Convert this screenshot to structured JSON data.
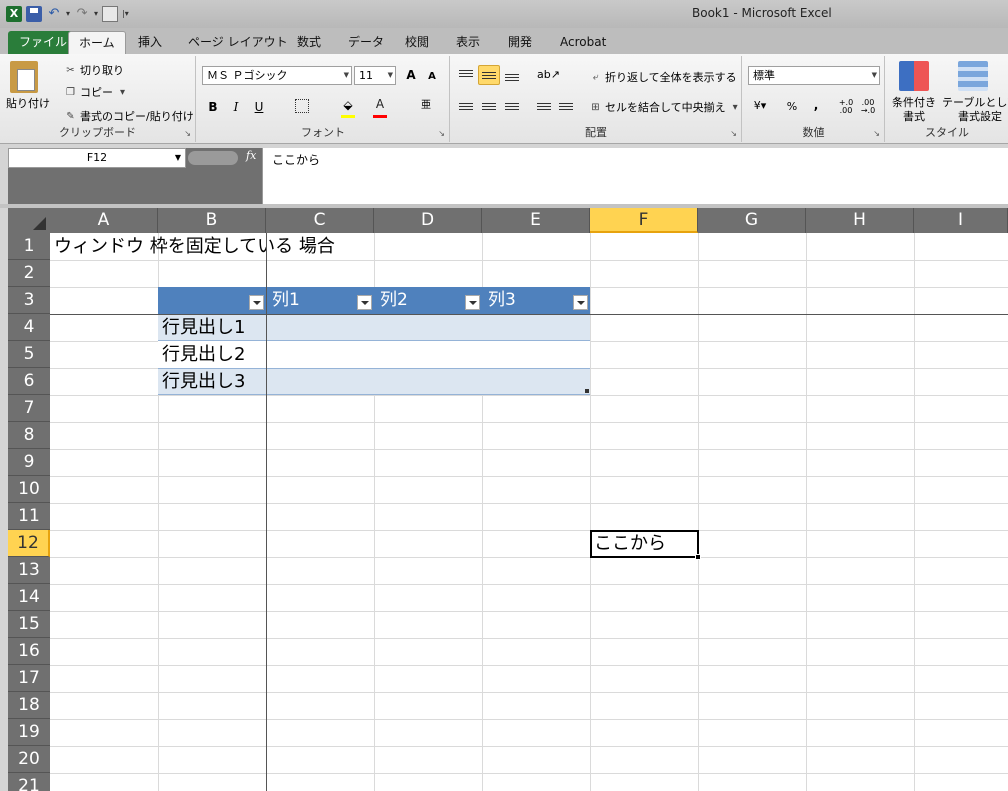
{
  "window": {
    "title": "Book1 - Microsoft Excel"
  },
  "quick_access": {
    "icons": [
      "excel-app-icon",
      "save-icon",
      "undo-icon",
      "redo-icon",
      "print-preview-icon"
    ]
  },
  "tabs": [
    "ファイル",
    "ホーム",
    "挿入",
    "ページ レイアウト",
    "数式",
    "データ",
    "校閲",
    "表示",
    "開発",
    "Acrobat"
  ],
  "ribbon": {
    "clipboard": {
      "label": "クリップボード",
      "paste": "貼り付け",
      "cut": "切り取り",
      "copy": "コピー",
      "format_painter": "書式のコピー/貼り付け"
    },
    "font": {
      "label": "フォント",
      "name": "ＭＳ Ｐゴシック",
      "size": "11",
      "bold": "B",
      "italic": "I",
      "underline": "U",
      "grow": "A",
      "shrink": "A"
    },
    "alignment": {
      "label": "配置",
      "wrap_text": "折り返して全体を表示する",
      "merge_center": "セルを結合して中央揃え"
    },
    "number": {
      "label": "数値",
      "format": "標準",
      "percent": "%",
      "comma": ",",
      "inc_decimal": "+.0\n.00",
      "dec_decimal": ".00\n→.0"
    },
    "styles": {
      "label": "スタイル",
      "conditional": "条件付き",
      "conditional2": "書式",
      "table": "テーブルとして",
      "table2": "書式設定"
    }
  },
  "formula_bar": {
    "namebox": "F12",
    "fx": "fx",
    "content": "ここから"
  },
  "columns": [
    "A",
    "B",
    "C",
    "D",
    "E",
    "F",
    "G",
    "H",
    "I"
  ],
  "selected_column": "F",
  "rows": [
    "1",
    "2",
    "3",
    "4",
    "5",
    "6",
    "7",
    "8",
    "9",
    "10",
    "11",
    "12",
    "13",
    "14",
    "15",
    "16",
    "17",
    "18",
    "19",
    "20",
    "21"
  ],
  "selected_row": "12",
  "cells": {
    "a1": "ウィンドウ 枠を固定している 場合",
    "table_headers": [
      "列1",
      "列2",
      "列3"
    ],
    "row_headers": [
      "行見出し1",
      "行見出し2",
      "行見出し3"
    ],
    "f12": "ここから"
  },
  "colors": {
    "table_header": "#4f81bd",
    "table_band": "#dce6f1",
    "selected_header": "#ffd351",
    "file_tab": "#2a7d3a"
  }
}
